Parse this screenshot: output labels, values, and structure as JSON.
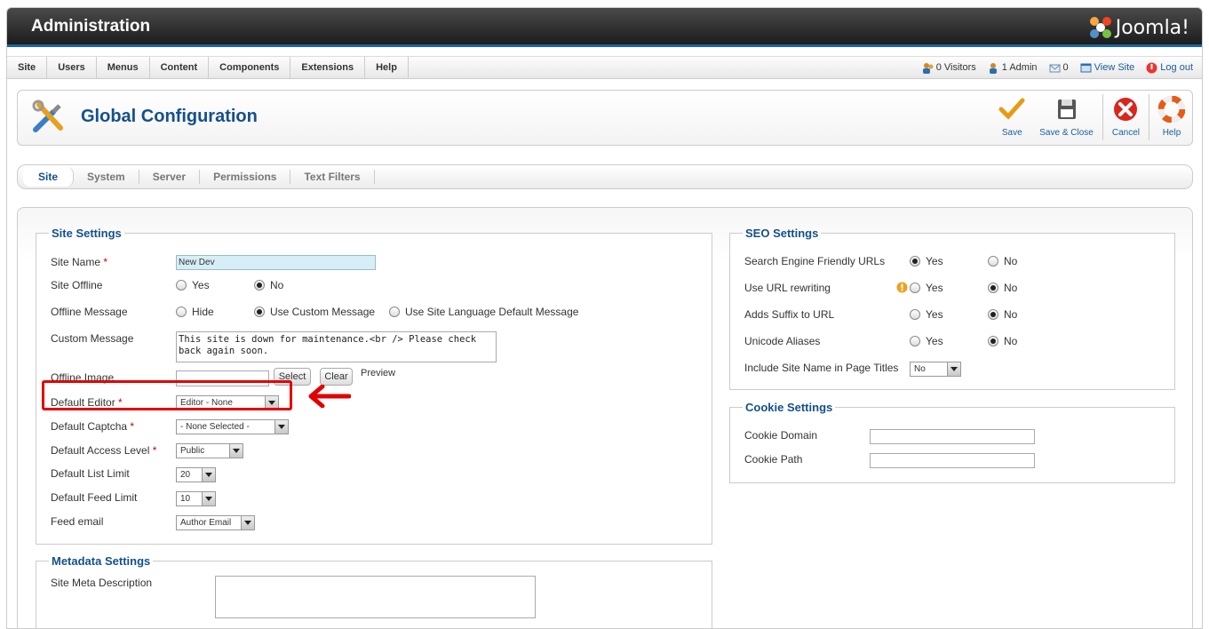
{
  "header": {
    "title": "Administration",
    "logo_text": "Joomla!"
  },
  "menu": [
    "Site",
    "Users",
    "Menus",
    "Content",
    "Components",
    "Extensions",
    "Help"
  ],
  "status": {
    "visitors": "0 Visitors",
    "admins": "1 Admin",
    "messages": "0",
    "view_site": "View Site",
    "logout": "Log out"
  },
  "toolbar": {
    "page_title": "Global Configuration",
    "save": "Save",
    "save_close": "Save & Close",
    "cancel": "Cancel",
    "help": "Help"
  },
  "tabs": [
    "Site",
    "System",
    "Server",
    "Permissions",
    "Text Filters"
  ],
  "site_settings": {
    "legend": "Site Settings",
    "site_name_label": "Site Name",
    "site_name_value": "New Dev",
    "site_offline_label": "Site Offline",
    "yes": "Yes",
    "no": "No",
    "offline_message_label": "Offline Message",
    "hide": "Hide",
    "use_custom": "Use Custom Message",
    "use_language": "Use Site Language Default Message",
    "custom_message_label": "Custom Message",
    "custom_message_value": "This site is down for maintenance.<br /> Please check back again soon.",
    "offline_image_label": "Offline Image",
    "select": "Select",
    "clear": "Clear",
    "preview": "Preview",
    "default_editor_label": "Default Editor",
    "default_editor_value": "Editor - None",
    "default_captcha_label": "Default Captcha",
    "default_captcha_value": "- None Selected -",
    "default_access_label": "Default Access Level",
    "default_access_value": "Public",
    "list_limit_label": "Default List Limit",
    "list_limit_value": "20",
    "feed_limit_label": "Default Feed Limit",
    "feed_limit_value": "10",
    "feed_email_label": "Feed email",
    "feed_email_value": "Author Email"
  },
  "metadata": {
    "legend": "Metadata Settings",
    "description_label": "Site Meta Description"
  },
  "seo": {
    "legend": "SEO Settings",
    "sef_label": "Search Engine Friendly URLs",
    "rewrite_label": "Use URL rewriting",
    "suffix_label": "Adds Suffix to URL",
    "unicode_label": "Unicode Aliases",
    "sitename_label": "Include Site Name in Page Titles",
    "sitename_value": "No",
    "yes": "Yes",
    "no": "No"
  },
  "cookie": {
    "legend": "Cookie Settings",
    "domain_label": "Cookie Domain",
    "path_label": "Cookie Path"
  },
  "colors": {
    "accent": "#15508a",
    "highlight": "#e30000"
  }
}
